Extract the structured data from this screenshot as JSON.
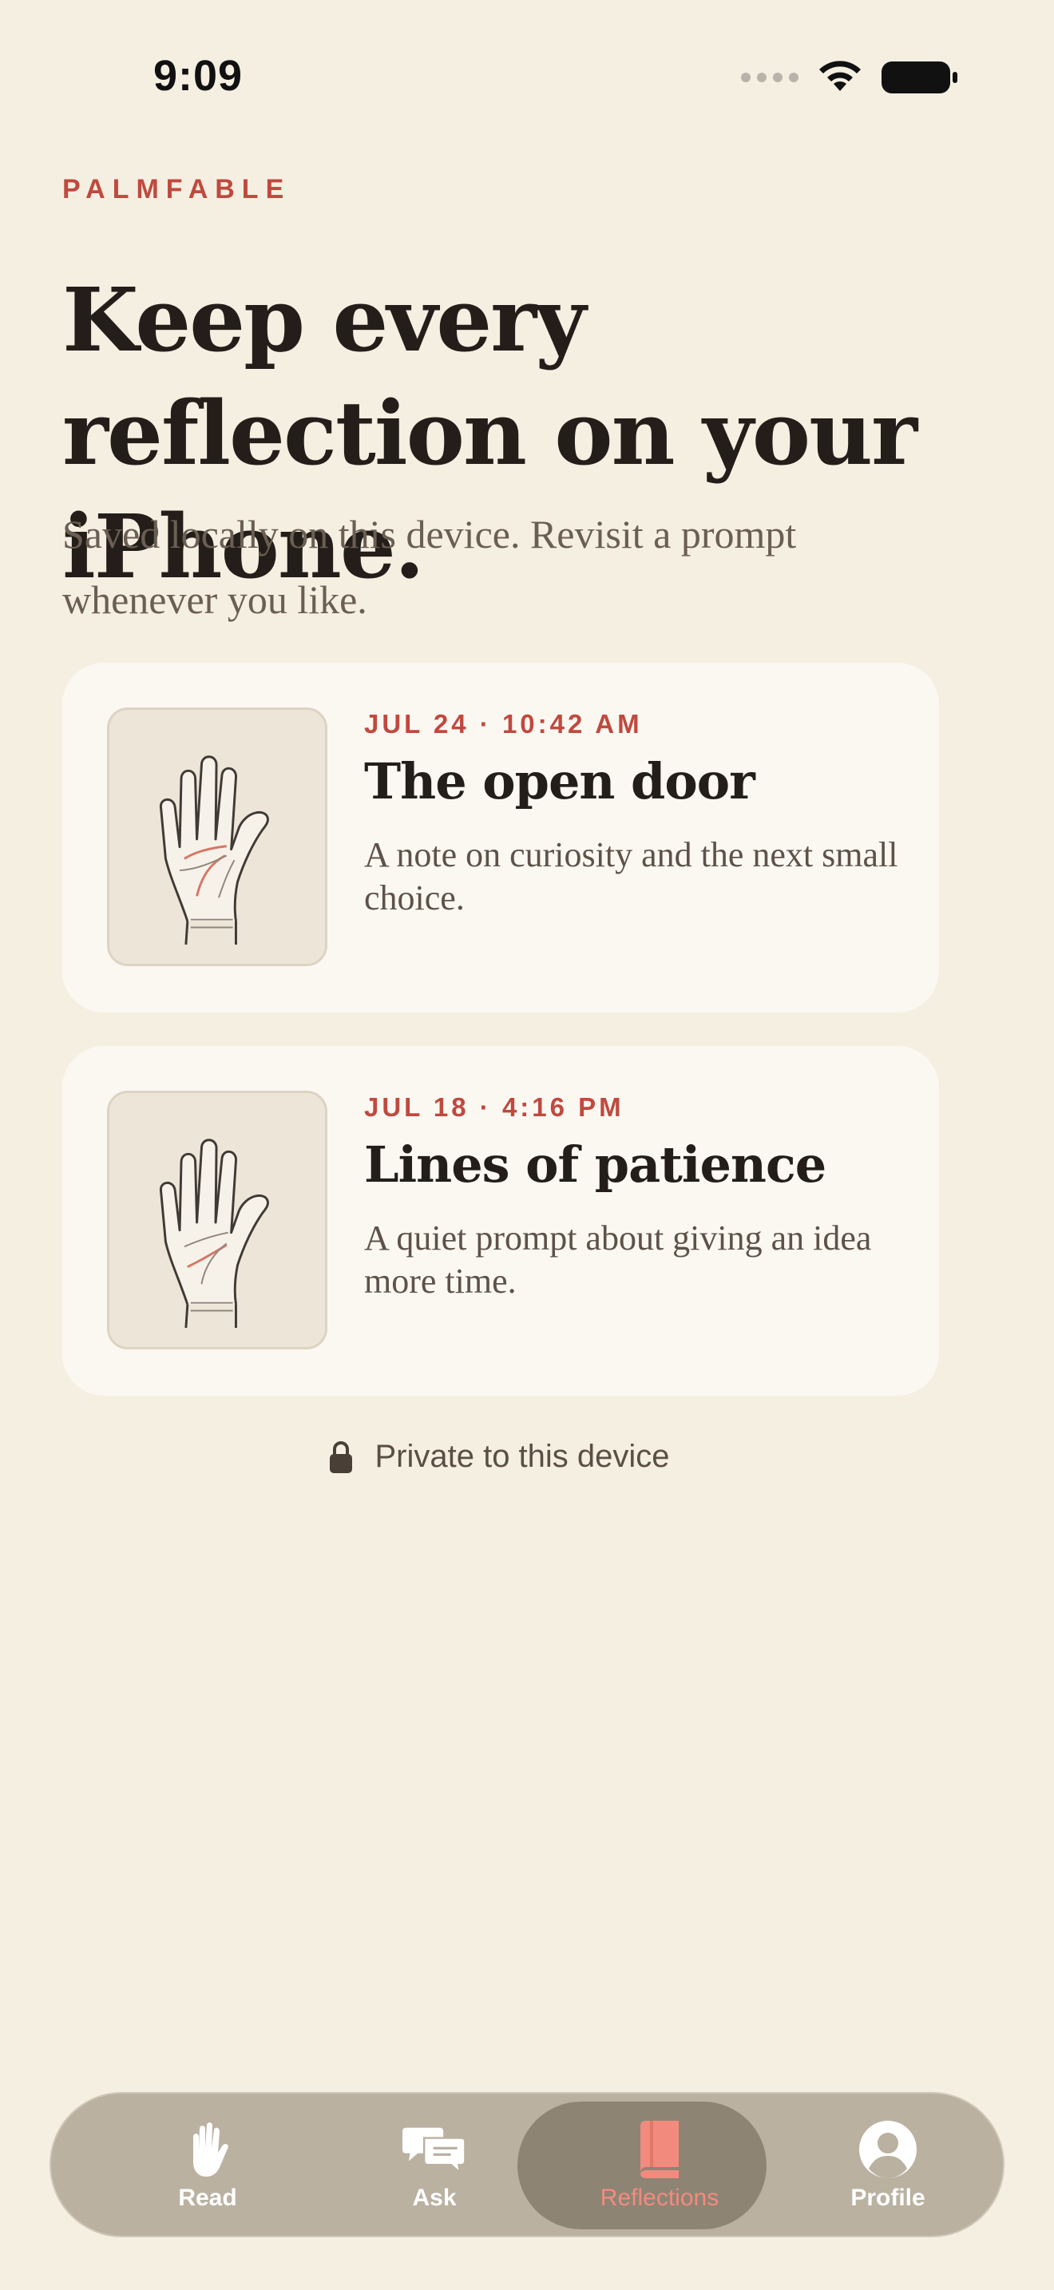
{
  "status_bar": {
    "time": "9:09"
  },
  "brand": "PALMFABLE",
  "header": {
    "title": "Keep every reflection on your iPhone.",
    "subtitle": "Saved locally on this device. Revisit a prompt whenever you like."
  },
  "reflections": [
    {
      "date": "JUL 24 · 10:42 AM",
      "title": "The open door",
      "description": "A note on curiosity and the next small choice.",
      "icon": "palm-illustration"
    },
    {
      "date": "JUL 18 · 4:16 PM",
      "title": "Lines of patience",
      "description": "A quiet prompt about giving an idea more time.",
      "icon": "palm-illustration"
    }
  ],
  "privacy_note": "Private to this device",
  "tab_bar": {
    "tabs": [
      {
        "label": "Read",
        "icon": "hand-icon"
      },
      {
        "label": "Ask",
        "icon": "chat-bubbles-icon"
      },
      {
        "label": "Reflections",
        "icon": "book-icon",
        "active": true
      },
      {
        "label": "Profile",
        "icon": "person-circle-icon"
      }
    ]
  },
  "colors": {
    "background": "#F5EFE2",
    "accent": "#C0493E",
    "card": "#FBF8F2",
    "tab_active": "#F28B7E"
  }
}
